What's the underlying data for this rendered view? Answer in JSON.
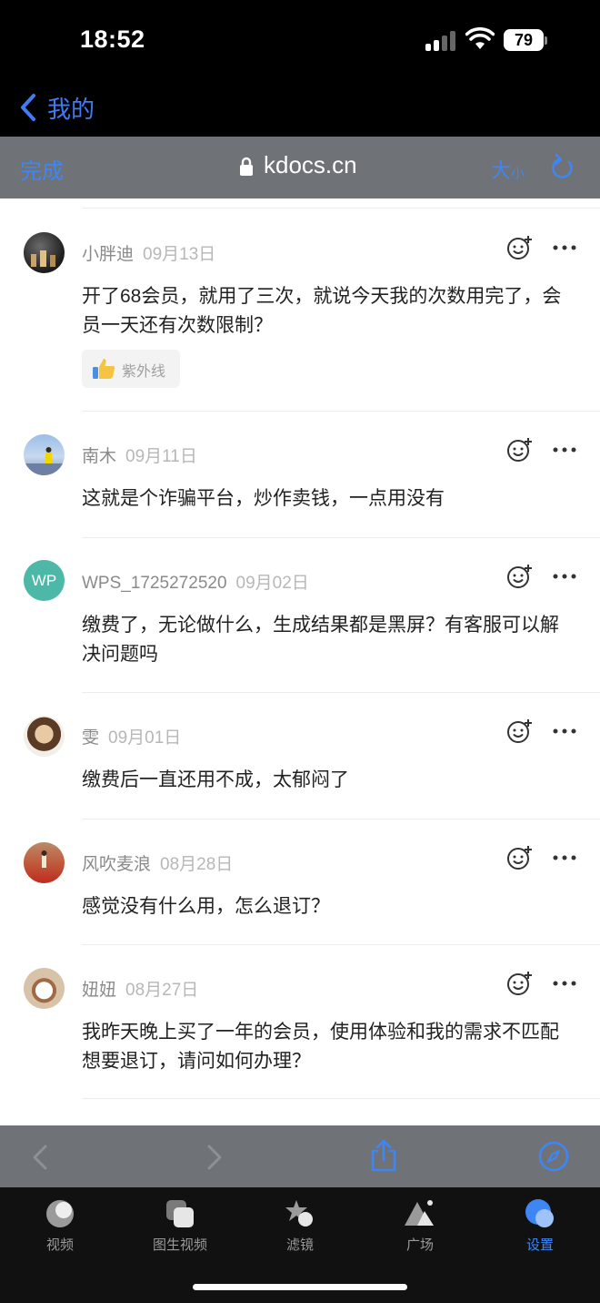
{
  "status_bar": {
    "time": "18:52",
    "battery": "79"
  },
  "nav": {
    "back_label": "我的"
  },
  "browser": {
    "done_label": "完成",
    "url": "kdocs.cn",
    "size_big": "大",
    "size_small": "小"
  },
  "comments": [
    {
      "user": "小胖迪",
      "date": "09月13日",
      "text": "开了68会员，就用了三次，就说今天我的次数用完了，会员一天还有次数限制？",
      "like_label": "紫外线"
    },
    {
      "user": "南木",
      "date": "09月11日",
      "text": "这就是个诈骗平台，炒作卖钱，一点用没有"
    },
    {
      "user": "WPS_1725272520",
      "date": "09月02日",
      "text": "缴费了，无论做什么，生成结果都是黑屏？有客服可以解决问题吗",
      "avatar_text": "WP"
    },
    {
      "user": "雯",
      "date": "09月01日",
      "text": "缴费后一直还用不成，太郁闷了"
    },
    {
      "user": "风吹麦浪",
      "date": "08月28日",
      "text": "感觉没有什么用，怎么退订？"
    },
    {
      "user": "妞妞",
      "date": "08月27日",
      "text": "我昨天晚上买了一年的会员，使用体验和我的需求不匹配想要退订，请问如何办理？"
    }
  ],
  "tabs": [
    {
      "label": "视频",
      "icon": "video-icon"
    },
    {
      "label": "图生视频",
      "icon": "image-to-video-icon"
    },
    {
      "label": "滤镜",
      "icon": "filter-icon"
    },
    {
      "label": "广场",
      "icon": "plaza-icon"
    },
    {
      "label": "设置",
      "icon": "settings-icon",
      "active": true
    }
  ],
  "colors": {
    "accent": "#3f86f5",
    "toolbar": "#6f7276"
  }
}
